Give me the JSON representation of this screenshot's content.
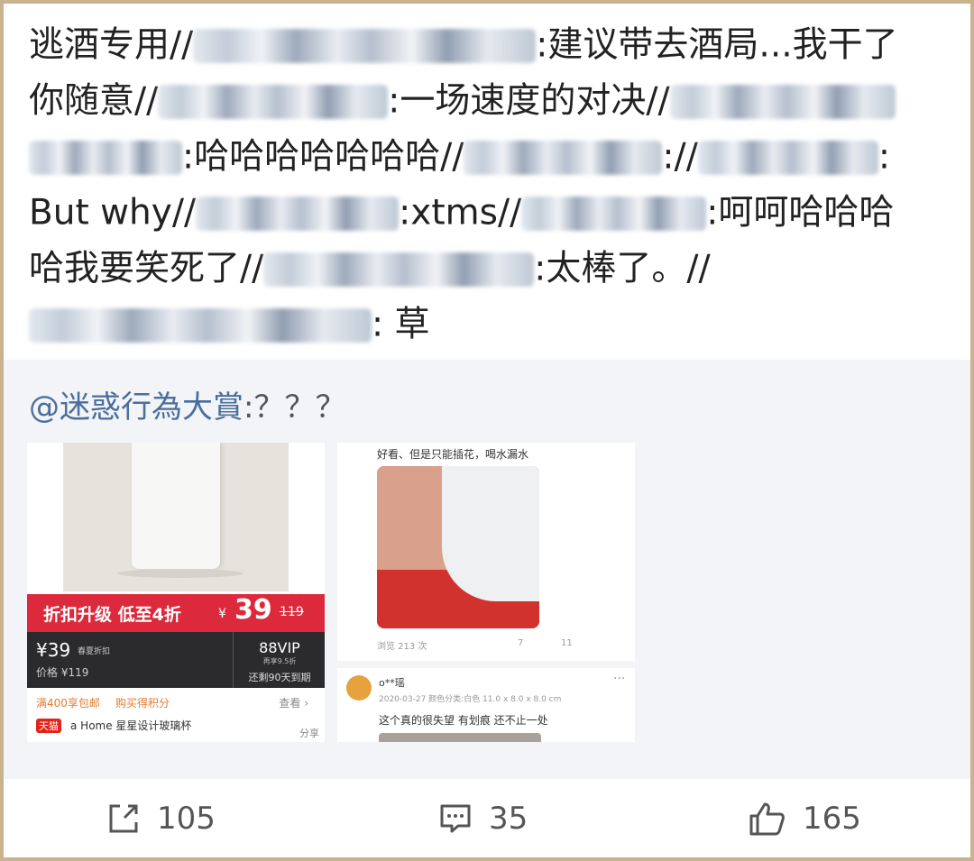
{
  "post": {
    "lines": [
      {
        "pre": "逃酒专用//",
        "post": ":建议带去酒局...我干了"
      },
      {
        "pre": "你随意//",
        "post": ":一场速度的对决//"
      },
      {
        "pre": "",
        "post": ":哈哈哈哈哈哈哈//"
      },
      {
        "pre": "But why//",
        "post": ":xtms//"
      },
      {
        "pre": "哈我要笑死了//",
        "post": ":太棒了。//"
      },
      {
        "pre": "",
        "post": ": 草"
      }
    ],
    "line3_tail1": "://",
    "line3_tail2": ":",
    "line4_tail": ":呵呵哈哈哈"
  },
  "repost": {
    "mention": "@迷惑行為大賞",
    "tail": ":？？？",
    "image1": {
      "promo": "折扣升级 低至4折",
      "yen": "¥",
      "price": "39",
      "old_price": "119",
      "dark_price": "¥39",
      "dark_tag": "春夏折扣",
      "dark_label": "价格 ¥119",
      "vip": "88VIP",
      "vip_sub": "再享9.5折",
      "vip_note": "还剩90天到期",
      "shipping": "满400享包邮",
      "points": "购买得积分",
      "more": "查看 ›",
      "store_badge": "天猫",
      "product": "a Home 星星设计玻璃杯",
      "share": "分享"
    },
    "image2": {
      "caption": "好看、但是只能插花，喝水漏水",
      "views": "浏览 213 次",
      "comments": "7",
      "likes": "11",
      "user": "o**瑶",
      "meta": "2020-03-27 颜色分类:白色 11.0 x 8.0 x 8.0 cm",
      "comment": "这个真的很失望 有划痕 还不止一处"
    }
  },
  "actions": {
    "share_count": "105",
    "comment_count": "35",
    "like_count": "165"
  }
}
